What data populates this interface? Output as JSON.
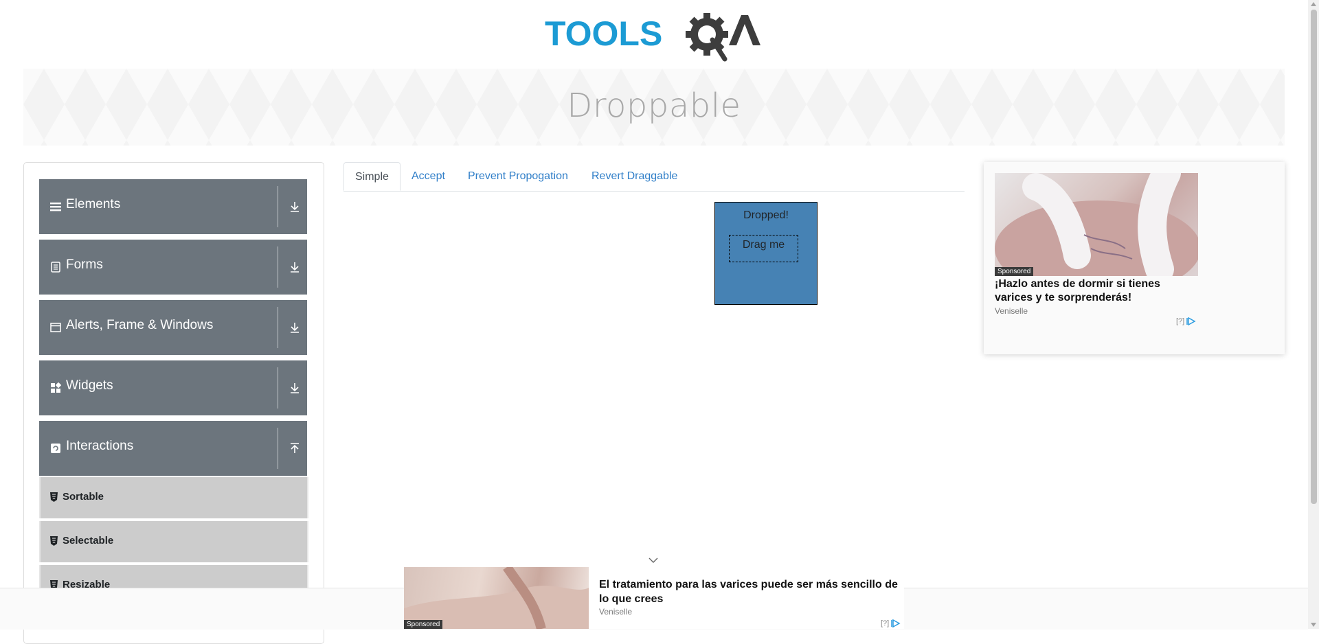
{
  "header": {
    "logo_text_left": "TOOLS",
    "logo_text_right": "QA",
    "banner_title": "Droppable"
  },
  "sidebar": {
    "groups": [
      {
        "label": "Elements",
        "icon": "hamburger-icon",
        "expanded": false
      },
      {
        "label": "Forms",
        "icon": "document-icon",
        "expanded": false
      },
      {
        "label": "Alerts, Frame & Windows",
        "icon": "window-icon",
        "expanded": false
      },
      {
        "label": "Widgets",
        "icon": "grid-icon",
        "expanded": false
      },
      {
        "label": "Interactions",
        "icon": "refresh-icon",
        "expanded": true
      }
    ],
    "items": [
      {
        "label": "Sortable",
        "icon": "html5-icon"
      },
      {
        "label": "Selectable",
        "icon": "html5-icon"
      },
      {
        "label": "Resizable",
        "icon": "html5-icon"
      }
    ]
  },
  "tabs": [
    {
      "label": "Simple",
      "active": true
    },
    {
      "label": "Accept",
      "active": false
    },
    {
      "label": "Prevent Propogation",
      "active": false
    },
    {
      "label": "Revert Draggable",
      "active": false
    }
  ],
  "droppable": {
    "drop_label": "Dropped!",
    "drag_label": "Drag me",
    "drop_color": "#4682b4"
  },
  "right_ad": {
    "sponsored": "Sponsored",
    "headline": "¡Hazlo antes de dormir si tienes varices y te sorprenderás!",
    "source": "Veniselle",
    "mark": "[?]"
  },
  "bottom_ad": {
    "sponsored": "Sponsored",
    "headline": "El tratamiento para las varices puede ser más sencillo de lo que crees",
    "source": "Veniselle",
    "mark": "[?]"
  },
  "colors": {
    "accent": "#1c9bd4",
    "sidebar_group_bg": "#6c757d",
    "sidebar_item_bg": "#cccccc",
    "tab_link": "#2f7ec8"
  }
}
